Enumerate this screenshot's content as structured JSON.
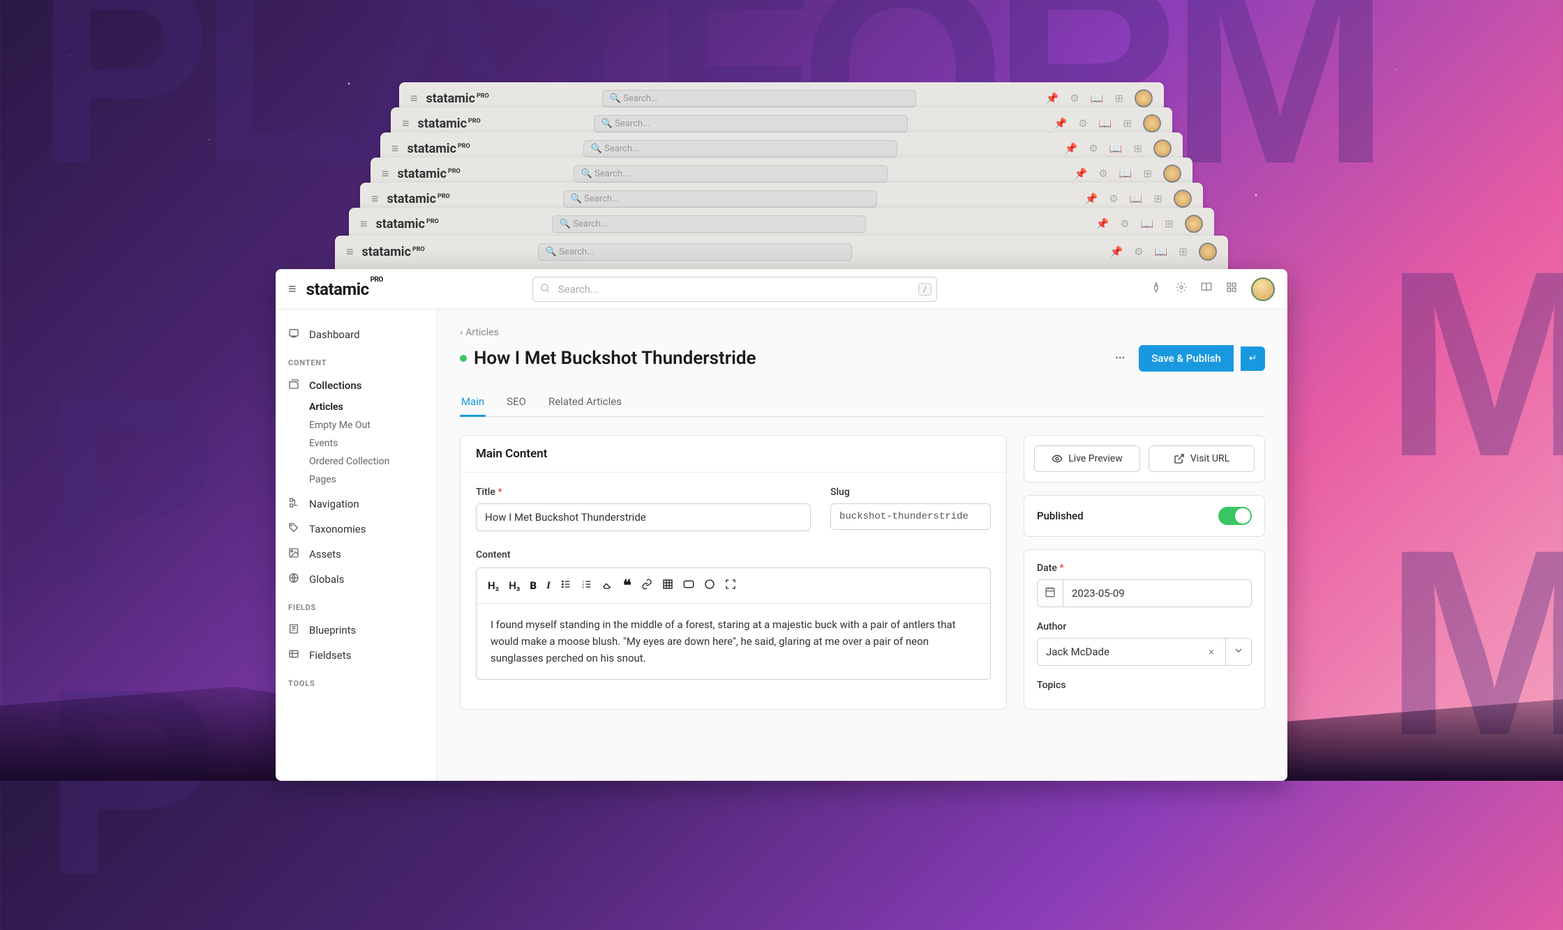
{
  "app": {
    "name": "statamic",
    "edition": "PRO"
  },
  "search": {
    "placeholder": "Search...",
    "shortcut": "/"
  },
  "sidebar": {
    "dashboard": "Dashboard",
    "sections": {
      "content": "CONTENT",
      "fields": "FIELDS",
      "tools": "TOOLS"
    },
    "collections": "Collections",
    "collection_items": [
      "Articles",
      "Empty Me Out",
      "Events",
      "Ordered Collection",
      "Pages"
    ],
    "navigation": "Navigation",
    "taxonomies": "Taxonomies",
    "assets": "Assets",
    "globals": "Globals",
    "blueprints": "Blueprints",
    "fieldsets": "Fieldsets"
  },
  "breadcrumb": "Articles",
  "page_title": "How I Met Buckshot Thunderstride",
  "save_button": "Save & Publish",
  "tabs": [
    "Main",
    "SEO",
    "Related Articles"
  ],
  "main_content": {
    "header": "Main Content",
    "title_label": "Title",
    "title_value": "How I Met Buckshot Thunderstride",
    "slug_label": "Slug",
    "slug_value": "buckshot-thunderstride",
    "content_label": "Content",
    "body": "I found myself standing in the middle of a forest, staring at a majestic buck with a pair of antlers that would make a moose blush. \"My eyes are down here\", he said, glaring at me over a pair of neon sunglasses perched on his snout."
  },
  "actions": {
    "live_preview": "Live Preview",
    "visit_url": "Visit URL"
  },
  "meta": {
    "published_label": "Published",
    "date_label": "Date",
    "date_value": "2023-05-09",
    "author_label": "Author",
    "author_value": "Jack McDade",
    "topics_label": "Topics"
  }
}
